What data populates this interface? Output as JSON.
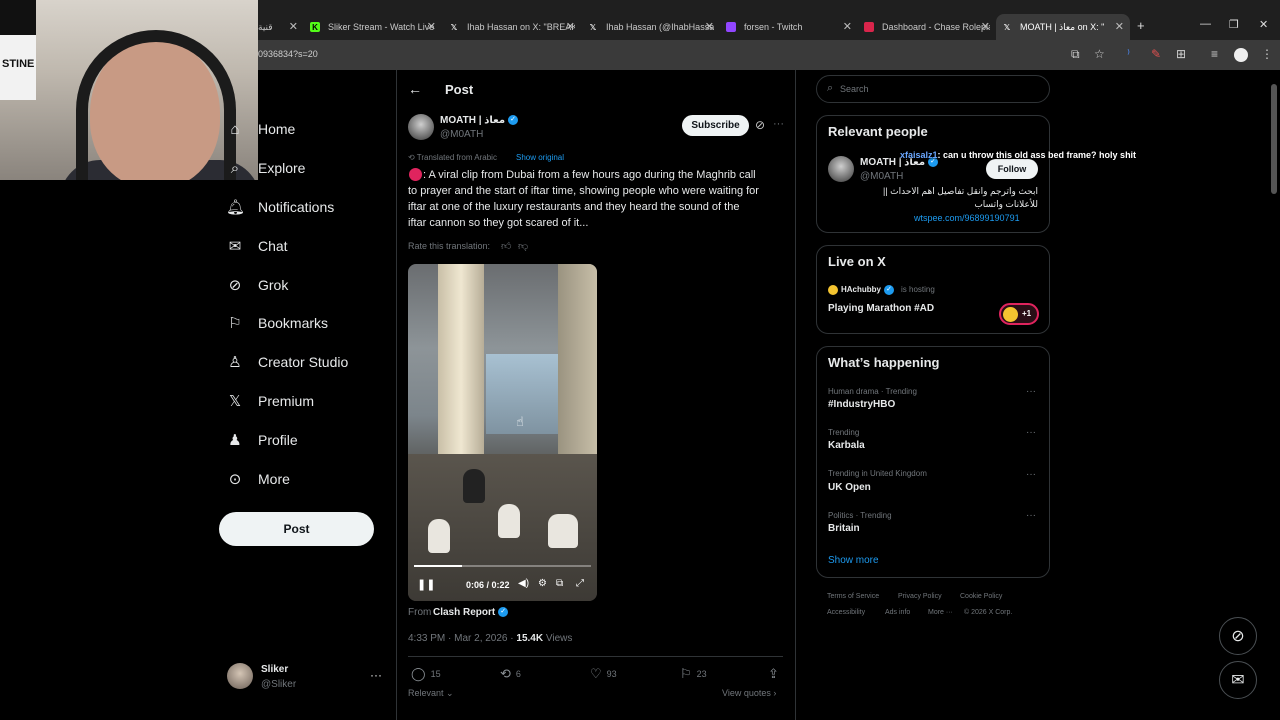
{
  "browser": {
    "tabs": [
      {
        "title": "قنية",
        "favicon_color": "#4a4a4a"
      },
      {
        "title": "Sliker Stream - Watch Live",
        "favicon_color": "#53fc18"
      },
      {
        "title": "Ihab Hassan on X: \"BREAK",
        "favicon_color": "#ffffff"
      },
      {
        "title": "Ihab Hassan (@IhabHassa",
        "favicon_color": "#ffffff"
      },
      {
        "title": "forsen - Twitch",
        "favicon_color": "#9146ff"
      },
      {
        "title": "Dashboard - Chase Roleplay",
        "favicon_color": "#d9254b"
      },
      {
        "title": "MOATH | معاذ on X: \"",
        "favicon_color": "#ffffff"
      }
    ],
    "url": "0936834?s=20",
    "new_tab": "+"
  },
  "nav": {
    "items": [
      {
        "label": "Home",
        "icon": "home-icon",
        "glyph": "⌂"
      },
      {
        "label": "Explore",
        "icon": "search-icon",
        "glyph": "⌕"
      },
      {
        "label": "Notifications",
        "icon": "bell-icon",
        "glyph": "♫"
      },
      {
        "label": "Chat",
        "icon": "mail-icon",
        "glyph": "✉"
      },
      {
        "label": "Grok",
        "icon": "grok-icon",
        "glyph": "⊘"
      },
      {
        "label": "Bookmarks",
        "icon": "bookmark-icon",
        "glyph": "⚑"
      },
      {
        "label": "Creator Studio",
        "icon": "flask-icon",
        "glyph": "♙"
      },
      {
        "label": "Premium",
        "icon": "x-logo-icon",
        "glyph": "𝕏"
      },
      {
        "label": "Profile",
        "icon": "person-icon",
        "glyph": "♟"
      },
      {
        "label": "More",
        "icon": "more-circle-icon",
        "glyph": "⊙"
      }
    ],
    "post_button": "Post",
    "account": {
      "name": "Sliker",
      "handle": "@Sliker",
      "more": "···"
    }
  },
  "post": {
    "header": "Post",
    "back": "←",
    "author": {
      "name": "MOATH | معاذ",
      "handle": "@M0ATH"
    },
    "subscribe": "Subscribe",
    "menu": "···",
    "translated_label": "Translated from Arabic",
    "show_original": "Show original",
    "text": [
      ": A viral clip from Dubai from a few hours ago during the Maghrib call",
      "to prayer and the start of iftar time, showing people who were waiting for",
      "iftar at one of the luxury restaurants and they heard the sound of the",
      "iftar cannon so they got scared of it..."
    ],
    "rate_label": "Rate this translation:",
    "video": {
      "time": "0:06 / 0:22",
      "progress": 0.27
    },
    "from_label": "From",
    "from_source": "Clash Report",
    "timestamp": "4:33 PM · Mar 2, 2026 · ",
    "views_count": "15.4K",
    "views_label": " Views",
    "actions": {
      "replies": "15",
      "reposts": "6",
      "likes": "93",
      "bookmarks": "23"
    },
    "sort": "Relevant",
    "view_quotes": "View quotes"
  },
  "sidebar": {
    "search_placeholder": "Search",
    "relevant": {
      "title": "Relevant people",
      "name": "MOATH | معاذ",
      "handle": "@M0ATH",
      "follow": "Follow",
      "bio_line1": "ابحث واترجم وانقل تفاصيل اهم الاحداث ||",
      "bio_line2": "للأعلانات واتساب",
      "link": "wtspee.com/96899190791"
    },
    "chat_overlay": {
      "user": "xfaisalz1",
      "message": ": can u throw this old ass bed frame? holy shit"
    },
    "live": {
      "title": "Live on X",
      "host": "HAchubby",
      "hosting": "is hosting",
      "stream_title": "Playing Marathon #AD",
      "extra": "+1"
    },
    "happening": {
      "title": "What’s happening",
      "trends": [
        {
          "meta": "Human drama · Trending",
          "name": "#IndustryHBO"
        },
        {
          "meta": "Trending",
          "name": "Karbala"
        },
        {
          "meta": "Trending in United Kingdom",
          "name": "UK Open"
        },
        {
          "meta": "Politics · Trending",
          "name": "Britain"
        }
      ],
      "show_more": "Show more"
    },
    "footer": {
      "terms": "Terms of Service",
      "privacy": "Privacy Policy",
      "cookie": "Cookie Policy",
      "accessibility": "Accessibility",
      "ads": "Ads info",
      "more": "More ···",
      "copyright": "© 2026 X Corp."
    }
  },
  "webcam": {
    "flag_text": "STINE"
  },
  "colors": {
    "accent": "#1d9bf0",
    "background": "#000000",
    "muted": "#71767b"
  }
}
